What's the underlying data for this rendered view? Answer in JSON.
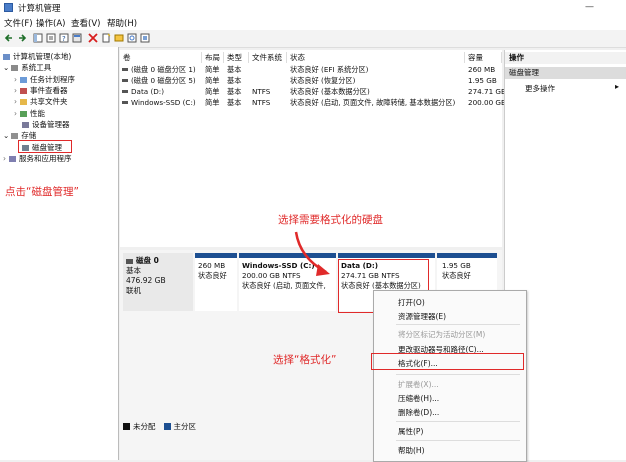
{
  "window": {
    "title": "计算机管理",
    "minimize_glyph": "—"
  },
  "menu": {
    "items": [
      "文件(F)",
      "操作(A)",
      "查看(V)",
      "帮助(H)"
    ]
  },
  "toolbar": {
    "icons": [
      "back-icon",
      "forward-icon",
      "show-tree-icon",
      "properties-icon",
      "help-icon",
      "view-icon",
      "delete-icon",
      "new-icon",
      "open-icon",
      "search-icon",
      "settings-icon"
    ]
  },
  "tree": {
    "root": "计算机管理(本地)",
    "system_tools": "系统工具",
    "task_scheduler": "任务计划程序",
    "event_viewer": "事件查看器",
    "shared_folders": "共享文件夹",
    "performance": "性能",
    "device_manager": "设备管理器",
    "storage": "存储",
    "disk_management": "磁盘管理",
    "services": "服务和应用程序"
  },
  "volumes": {
    "headers": {
      "volume": "卷",
      "layout": "布局",
      "type": "类型",
      "fs": "文件系统",
      "status": "状态",
      "capacity": "容量"
    },
    "rows": [
      {
        "volume": "(磁盘 0 磁盘分区 1)",
        "layout": "简单",
        "type": "基本",
        "fs": "",
        "status": "状态良好 (EFI 系统分区)",
        "capacity": "260 MB"
      },
      {
        "volume": "(磁盘 0 磁盘分区 5)",
        "layout": "简单",
        "type": "基本",
        "fs": "",
        "status": "状态良好 (恢复分区)",
        "capacity": "1.95 GB"
      },
      {
        "volume": "Data (D:)",
        "layout": "简单",
        "type": "基本",
        "fs": "NTFS",
        "status": "状态良好 (基本数据分区)",
        "capacity": "274.71 GB"
      },
      {
        "volume": "Windows-SSD (C:)",
        "layout": "简单",
        "type": "基本",
        "fs": "NTFS",
        "status": "状态良好 (启动, 页面文件, 故障转储, 基本数据分区)",
        "capacity": "200.00 GB"
      }
    ]
  },
  "actions": {
    "header": "操作",
    "section": "磁盘管理",
    "more": "更多操作",
    "arrow": "▸"
  },
  "disk": {
    "name": "磁盘 0",
    "type": "基本",
    "size": "476.92 GB",
    "status": "联机",
    "partitions": [
      {
        "title": "",
        "size": "260 MB",
        "status": "状态良好"
      },
      {
        "title": "Windows-SSD  (C:)",
        "size": "200.00 GB NTFS",
        "status": "状态良好 (启动, 页面文件,"
      },
      {
        "title": "Data  (D:)",
        "size": "274.71 GB NTFS",
        "status": "状态良好 (基本数据分区)"
      },
      {
        "title": "",
        "size": "1.95 GB",
        "status": "状态良好"
      }
    ]
  },
  "legend": {
    "unallocated": "未分配",
    "primary": "主分区"
  },
  "context_menu": {
    "open": "打开(O)",
    "explore": "资源管理器(E)",
    "mark_active": "将分区标记为活动分区(M)",
    "change_letter": "更改驱动器号和路径(C)...",
    "format": "格式化(F)...",
    "extend": "扩展卷(X)...",
    "shrink": "压缩卷(H)...",
    "delete": "删除卷(D)...",
    "properties": "属性(P)",
    "help": "帮助(H)"
  },
  "annotations": {
    "click_disk_mgmt": "点击“磁盘管理”",
    "select_disk": "选择需要格式化的硬盘",
    "select_format": "选择“格式化”",
    "color": "#e02a2a"
  }
}
